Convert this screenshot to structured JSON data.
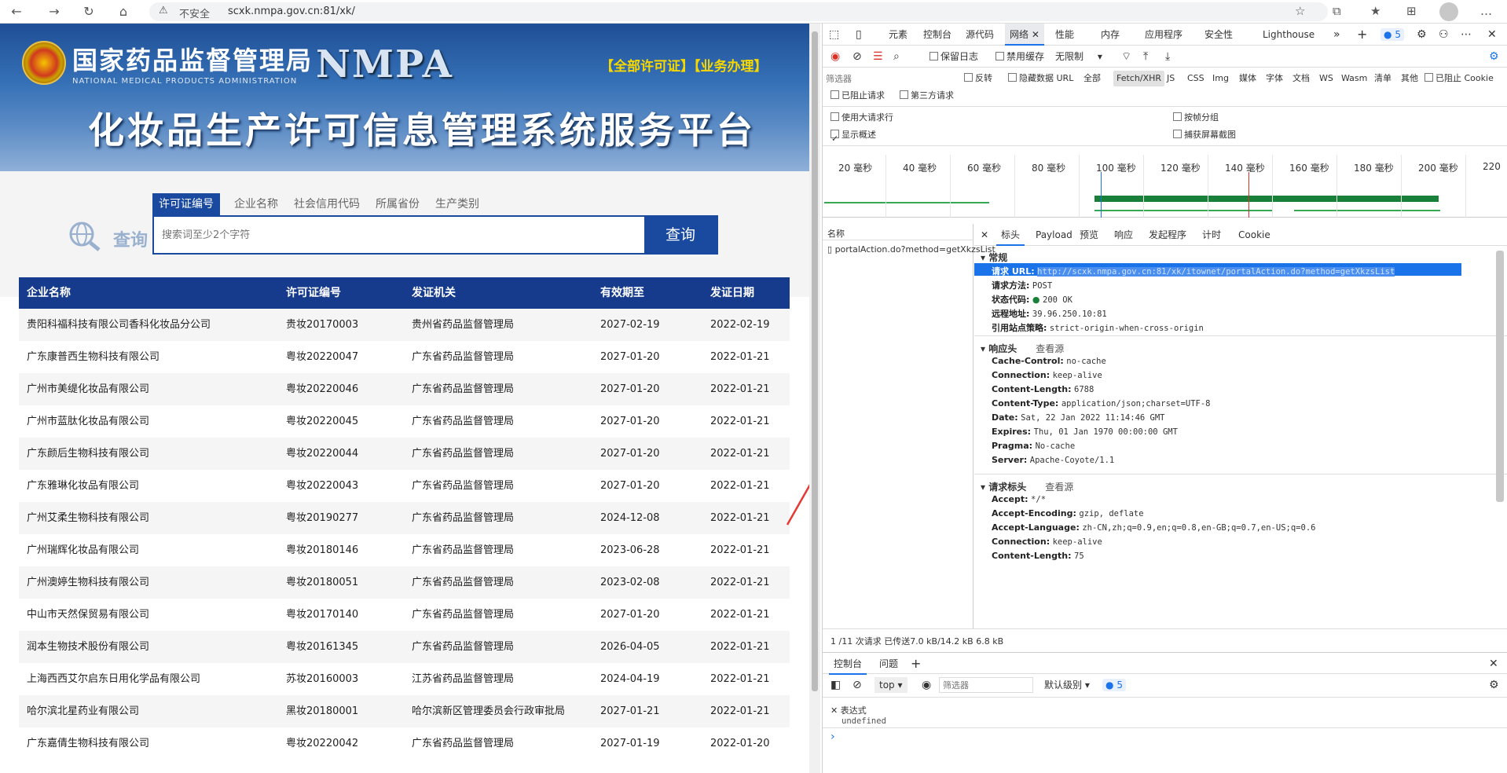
{
  "browser": {
    "insecure_label": "不安全",
    "url": "scxk.nmpa.gov.cn:81/xk/"
  },
  "banner": {
    "agency_name": "国家药品监督管理局",
    "agency_en": "NATIONAL MEDICAL PRODUCTS ADMINISTRATION",
    "nmpa": "NMPA",
    "top_links": "【全部许可证】【业务办理】",
    "platform_title": "化妆品生产许可信息管理系统服务平台"
  },
  "search": {
    "logo_text": "查询",
    "tabs": [
      "许可证编号",
      "企业名称",
      "社会信用代码",
      "所属省份",
      "生产类别"
    ],
    "placeholder": "搜索词至少2个字符",
    "button": "查询"
  },
  "table": {
    "headers": [
      "企业名称",
      "许可证编号",
      "发证机关",
      "有效期至",
      "发证日期"
    ],
    "rows": [
      [
        "贵阳科福科技有限公司香科化妆品分公司",
        "贵妆20170003",
        "贵州省药品监督管理局",
        "2027-02-19",
        "2022-02-19"
      ],
      [
        "广东康普西生物科技有限公司",
        "粤妆20220047",
        "广东省药品监督管理局",
        "2027-01-20",
        "2022-01-21"
      ],
      [
        "广州市美缇化妆品有限公司",
        "粤妆20220046",
        "广东省药品监督管理局",
        "2027-01-20",
        "2022-01-21"
      ],
      [
        "广州市蓝肽化妆品有限公司",
        "粤妆20220045",
        "广东省药品监督管理局",
        "2027-01-20",
        "2022-01-21"
      ],
      [
        "广东颜后生物科技有限公司",
        "粤妆20220044",
        "广东省药品监督管理局",
        "2027-01-20",
        "2022-01-21"
      ],
      [
        "广东雅琳化妆品有限公司",
        "粤妆20220043",
        "广东省药品监督管理局",
        "2027-01-20",
        "2022-01-21"
      ],
      [
        "广州艾柔生物科技有限公司",
        "粤妆20190277",
        "广东省药品监督管理局",
        "2024-12-08",
        "2022-01-21"
      ],
      [
        "广州瑞辉化妆品有限公司",
        "粤妆20180146",
        "广东省药品监督管理局",
        "2023-06-28",
        "2022-01-21"
      ],
      [
        "广州澳婷生物科技有限公司",
        "粤妆20180051",
        "广东省药品监督管理局",
        "2023-02-08",
        "2022-01-21"
      ],
      [
        "中山市天然保贸易有限公司",
        "粤妆20170140",
        "广东省药品监督管理局",
        "2027-01-20",
        "2022-01-21"
      ],
      [
        "润本生物技术股份有限公司",
        "粤妆20161345",
        "广东省药品监督管理局",
        "2026-04-05",
        "2022-01-21"
      ],
      [
        "上海西西艾尔启东日用化学品有限公司",
        "苏妆20160003",
        "江苏省药品监督管理局",
        "2024-04-19",
        "2022-01-21"
      ],
      [
        "哈尔滨北星药业有限公司",
        "黑妆20180001",
        "哈尔滨新区管理委员会行政审批局",
        "2027-01-21",
        "2022-01-21"
      ],
      [
        "广东嘉倩生物科技有限公司",
        "粤妆20220042",
        "广东省药品监督管理局",
        "2027-01-19",
        "2022-01-20"
      ]
    ]
  },
  "devtools": {
    "tabs": [
      "元素",
      "控制台",
      "源代码",
      "网络",
      "性能",
      "内存",
      "应用程序",
      "安全性",
      "Lighthouse"
    ],
    "issue_count": "5",
    "toolbar": {
      "preserve_log": "保留日志",
      "disable_cache": "禁用缓存",
      "throttle": "无限制"
    },
    "filter": {
      "placeholder": "筛选器",
      "invert": "反转",
      "hide_data_urls": "隐藏数据 URL",
      "types": [
        "全部",
        "Fetch/XHR",
        "JS",
        "CSS",
        "Img",
        "媒体",
        "字体",
        "文档",
        "WS",
        "Wasm",
        "清单",
        "其他"
      ],
      "blocked_cookies": "已阻止 Cookie",
      "blocked_requests": "已阻止请求",
      "third_party": "第三方请求"
    },
    "options": {
      "large_rows": "使用大请求行",
      "group_by_frame": "按帧分组",
      "show_overview": "显示概述",
      "capture_screenshots": "捕获屏幕截图"
    },
    "timeline_ticks": [
      "20 毫秒",
      "40 毫秒",
      "60 毫秒",
      "80 毫秒",
      "100 毫秒",
      "120 毫秒",
      "140 毫秒",
      "160 毫秒",
      "180 毫秒",
      "200 毫秒",
      "220"
    ],
    "name_header": "名称",
    "request_name": "portalAction.do?method=getXkzsList",
    "detail_tabs": [
      "标头",
      "Payload",
      "预览",
      "响应",
      "发起程序",
      "计时",
      "Cookie"
    ],
    "general": {
      "title": "常规",
      "items": [
        {
          "k": "请求 URL:",
          "v": "http://scxk.nmpa.gov.cn:81/xk/itownet/portalAction.do?method=getXkzsList"
        },
        {
          "k": "请求方法:",
          "v": "POST"
        },
        {
          "k": "状态代码:",
          "v": "200 OK"
        },
        {
          "k": "远程地址:",
          "v": "39.96.250.10:81"
        },
        {
          "k": "引用站点策略:",
          "v": "strict-origin-when-cross-origin"
        }
      ]
    },
    "response_headers": {
      "title": "响应头",
      "view_source": "查看源",
      "items": [
        {
          "k": "Cache-Control:",
          "v": "no-cache"
        },
        {
          "k": "Connection:",
          "v": "keep-alive"
        },
        {
          "k": "Content-Length:",
          "v": "6788"
        },
        {
          "k": "Content-Type:",
          "v": "application/json;charset=UTF-8"
        },
        {
          "k": "Date:",
          "v": "Sat, 22 Jan 2022 11:14:46 GMT"
        },
        {
          "k": "Expires:",
          "v": "Thu, 01 Jan 1970 00:00:00 GMT"
        },
        {
          "k": "Pragma:",
          "v": "No-cache"
        },
        {
          "k": "Server:",
          "v": "Apache-Coyote/1.1"
        }
      ]
    },
    "request_headers": {
      "title": "请求标头",
      "view_source": "查看源",
      "items": [
        {
          "k": "Accept:",
          "v": "*/*"
        },
        {
          "k": "Accept-Encoding:",
          "v": "gzip, deflate"
        },
        {
          "k": "Accept-Language:",
          "v": "zh-CN,zh;q=0.9,en;q=0.8,en-GB;q=0.7,en-US;q=0.6"
        },
        {
          "k": "Connection:",
          "v": "keep-alive"
        },
        {
          "k": "Content-Length:",
          "v": "75"
        }
      ]
    },
    "status_bar": "1 /11 次请求  已传送7.0 kB/14.2 kB  6.8 kB",
    "console": {
      "tabs": [
        "控制台",
        "问题"
      ],
      "context": "top",
      "filter_placeholder": "筛选器",
      "level": "默认级别",
      "issue_count": "5",
      "expression_label": "表达式",
      "expression_value": "undefined",
      "prompt": "›"
    }
  },
  "colors": {
    "brand_blue": "#1a4aa0",
    "table_header": "#163b8c",
    "accent_yellow": "#f6d800",
    "selection": "#1a73e8",
    "annotation_arrow": "#e53935"
  }
}
